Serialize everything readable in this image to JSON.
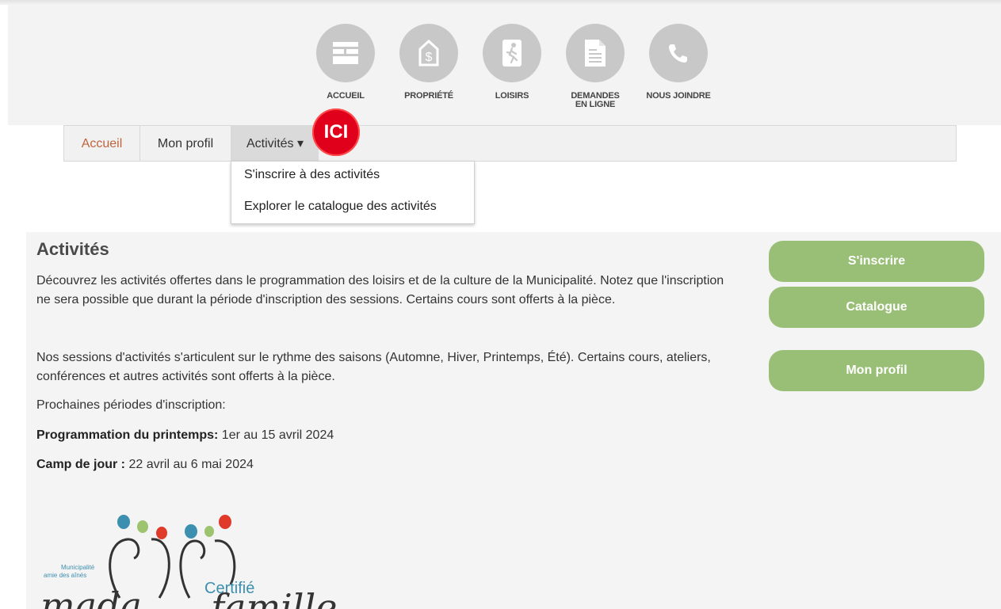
{
  "nav": {
    "items": [
      {
        "label": "ACCUEIL",
        "icon": "layout-icon"
      },
      {
        "label": "PROPRIÉTÉ",
        "icon": "dollar-house-icon"
      },
      {
        "label": "LOISIRS",
        "icon": "running-person-icon"
      },
      {
        "label": "DEMANDES EN LIGNE",
        "icon": "document-icon"
      },
      {
        "label": "NOUS JOINDRE",
        "icon": "phone-icon"
      }
    ]
  },
  "tabs": {
    "accueil": "Accueil",
    "profil": "Mon profil",
    "activites": "Activités ▾"
  },
  "badge": "ICI",
  "dropdown": {
    "item1": "S'inscrire à des activités",
    "item2": "Explorer le catalogue des activités"
  },
  "content": {
    "title": "Activités",
    "p1": "Découvrez les activités offertes dans le programmation des loisirs et de la culture de la Municipalité. Notez que l'inscription ne sera possible que durant la période d'inscription des sessions. Certains cours sont offerts à la pièce.",
    "p2": "Nos sessions d'activités s'articulent sur le rythme des saisons (Automne, Hiver, Printemps, Été). Certains cours, ateliers, conférences et autres activités sont offerts à la pièce.",
    "p3": "Prochaines périodes d'inscription:",
    "p4_label": "Programmation du printemps:",
    "p4_value": " 1er au 15 avril 2024",
    "p5_label": "Camp de jour :",
    "p5_value": " 22 avril au 6 mai 2024"
  },
  "buttons": {
    "inscrire": "S'inscrire",
    "catalogue": "Catalogue",
    "profil": "Mon profil"
  },
  "logos": {
    "mada_line1": "Municipalité",
    "mada_line2": "amie des aînés",
    "mada_word": "mada",
    "famille_certifie": "Certifié",
    "famille_word": "famille"
  },
  "colors": {
    "accent_green": "#99bf77",
    "badge_red": "#e0001b",
    "link_orange": "#c0633c",
    "icon_grey": "#c8c8c8"
  }
}
